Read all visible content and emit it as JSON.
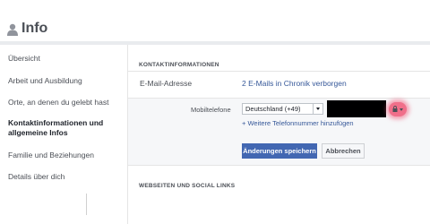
{
  "header": {
    "title": "Info",
    "icon": "person-icon"
  },
  "sidebar": {
    "items": [
      {
        "label": "Übersicht",
        "active": false
      },
      {
        "label": "Arbeit und Ausbildung",
        "active": false
      },
      {
        "label": "Orte, an denen du gelebt hast",
        "active": false
      },
      {
        "label": "Kontaktinformationen und allgemeine Infos",
        "active": true
      },
      {
        "label": "Familie und Beziehungen",
        "active": false
      },
      {
        "label": "Details über dich",
        "active": false
      }
    ]
  },
  "contact": {
    "section_title": "KONTAKTINFORMATIONEN",
    "email_label": "E-Mail-Adresse",
    "email_value": "2 E-Mails in Chronik verborgen",
    "mobile_label": "Mobiltelefone",
    "country_selected": "Deutschland (+49)",
    "phone_value": "",
    "add_phone_link": "+ Weitere Telefonnummer hinzufügen",
    "save_button": "Änderungen speichern",
    "cancel_button": "Abbrechen",
    "privacy_icon": "lock-icon"
  },
  "websites": {
    "section_title": "WEBSEITEN UND SOCIAL LINKS"
  },
  "colors": {
    "accent": "#4267b2",
    "link": "#365899",
    "highlight": "#f06f8a"
  }
}
